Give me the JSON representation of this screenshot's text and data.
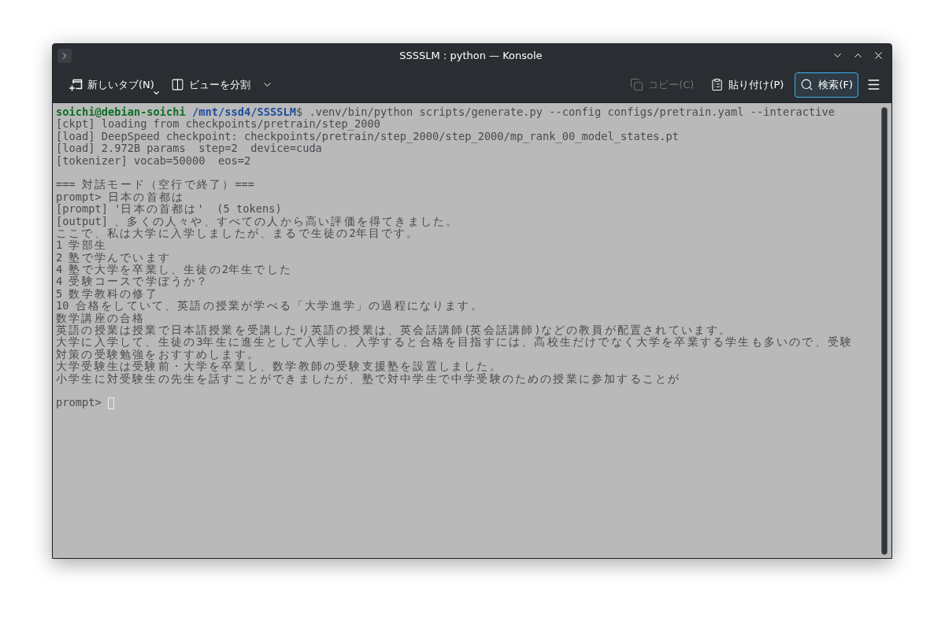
{
  "window": {
    "title": "SSSSLM : python — Konsole"
  },
  "toolbar": {
    "left": [
      {
        "kind": "new-tab",
        "label": "新しいタブ(N)",
        "disabled": false,
        "active": false,
        "menu": true
      },
      {
        "kind": "split-view",
        "label": "ビューを分割",
        "disabled": false,
        "active": false,
        "menu": true
      }
    ],
    "right": [
      {
        "kind": "copy",
        "label": "コピー(C)",
        "disabled": true,
        "active": false,
        "menu": false
      },
      {
        "kind": "paste",
        "label": "貼り付け(P)",
        "disabled": false,
        "active": false,
        "menu": false
      },
      {
        "kind": "search",
        "label": "検索(F)",
        "disabled": false,
        "active": true,
        "menu": false
      }
    ]
  },
  "terminal": {
    "command": {
      "user": "soichi@debian-soichi",
      "path": "/mnt/ssd4/SSSSLM",
      "input": "$ .venv/bin/python scripts/generate.py --config configs/pretrain.yaml --interactive"
    },
    "blocks": [
      [
        "[ckpt] loading from checkpoints/pretrain/step_2000",
        "[load] DeepSpeed checkpoint: checkpoints/pretrain/step_2000/step_2000/mp_rank_00_model_states.pt",
        "[load] 2.972B params  step=2  device=cuda",
        "[tokenizer] vocab=50000  eos=2"
      ],
      [
        "=== 対話モード（空行で終了）===",
        "prompt> 日本の首都は",
        "[prompt] '日本の首都は'  (5 tokens)",
        "[output] 、多くの人々や、すべての人から高い評価を得てきました。",
        "ここで、私は大学に入学しましたが、まるで生徒の2年目です。",
        "1 学部生",
        "2 塾で学んでいます",
        "4 塾で大学を卒業し、生徒の2年生でした",
        "4 受験コースで学ぼうか？",
        "5 数学教科の修了",
        "10 合格をしていて、英語の授業が学べる「大学進学」の過程になります。",
        "数学講座の合格",
        "英語の授業は授業で日本語授業を受講したり英語の授業は、英会話講師(英会話講師)などの教員が配置されています。",
        "大学に入学して、生徒の3年生に進生として入学し、入学すると合格を目指すには、高校生だけでなく大学を卒業する学生も多いので、受験",
        "対策の受験勉強をおすすめします。",
        "大学受験生は受験前・大学を卒業し、数学教師の受験支援塾を設置しました。",
        "小学生に対受験生の先生を話すことができましたが、塾で対中学生で中学受験のための授業に参加することが"
      ]
    ],
    "prompt": {
      "text": "prompt>",
      "cursor": true
    }
  }
}
